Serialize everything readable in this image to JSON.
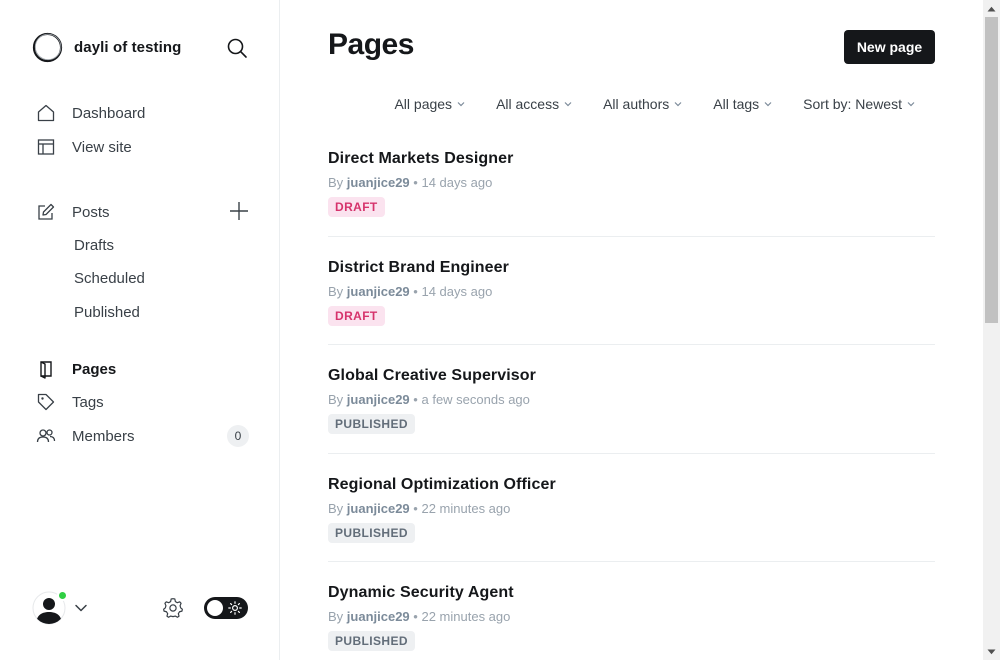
{
  "sidebar": {
    "brand_name": "dayli of testing",
    "nav": {
      "dashboard": "Dashboard",
      "view_site": "View site",
      "posts": "Posts",
      "drafts": "Drafts",
      "scheduled": "Scheduled",
      "published": "Published",
      "pages": "Pages",
      "tags": "Tags",
      "members": "Members",
      "members_count": "0"
    },
    "icons": {
      "brand": "brand-ring-logo",
      "search": "search-icon",
      "dashboard": "home-icon",
      "view_site": "layout-icon",
      "posts": "pencil-icon",
      "posts_add": "plus-icon",
      "pages": "page-icon",
      "tags": "tag-icon",
      "members": "members-icon",
      "settings": "gear-icon",
      "theme": "sun-icon"
    }
  },
  "main": {
    "title": "Pages",
    "new_button": "New page",
    "filters": [
      "All pages",
      "All access",
      "All authors",
      "All tags",
      "Sort by: Newest"
    ],
    "by_label": "By",
    "separator": "•",
    "rows": [
      {
        "title": "Direct Markets Designer",
        "author": "juanjice29",
        "time": "14 days ago",
        "status": "DRAFT"
      },
      {
        "title": "District Brand Engineer",
        "author": "juanjice29",
        "time": "14 days ago",
        "status": "DRAFT"
      },
      {
        "title": "Global Creative Supervisor",
        "author": "juanjice29",
        "time": "a few seconds ago",
        "status": "PUBLISHED"
      },
      {
        "title": "Regional Optimization Officer",
        "author": "juanjice29",
        "time": "22 minutes ago",
        "status": "PUBLISHED"
      },
      {
        "title": "Dynamic Security Agent",
        "author": "juanjice29",
        "time": "22 minutes ago",
        "status": "PUBLISHED"
      }
    ]
  },
  "colors": {
    "accent": "#15171a",
    "draft_bg": "#fbe3ef",
    "draft_text": "#d6336c",
    "published_bg": "#eef0f2",
    "published_text": "#626d79",
    "online": "#30cf43"
  }
}
